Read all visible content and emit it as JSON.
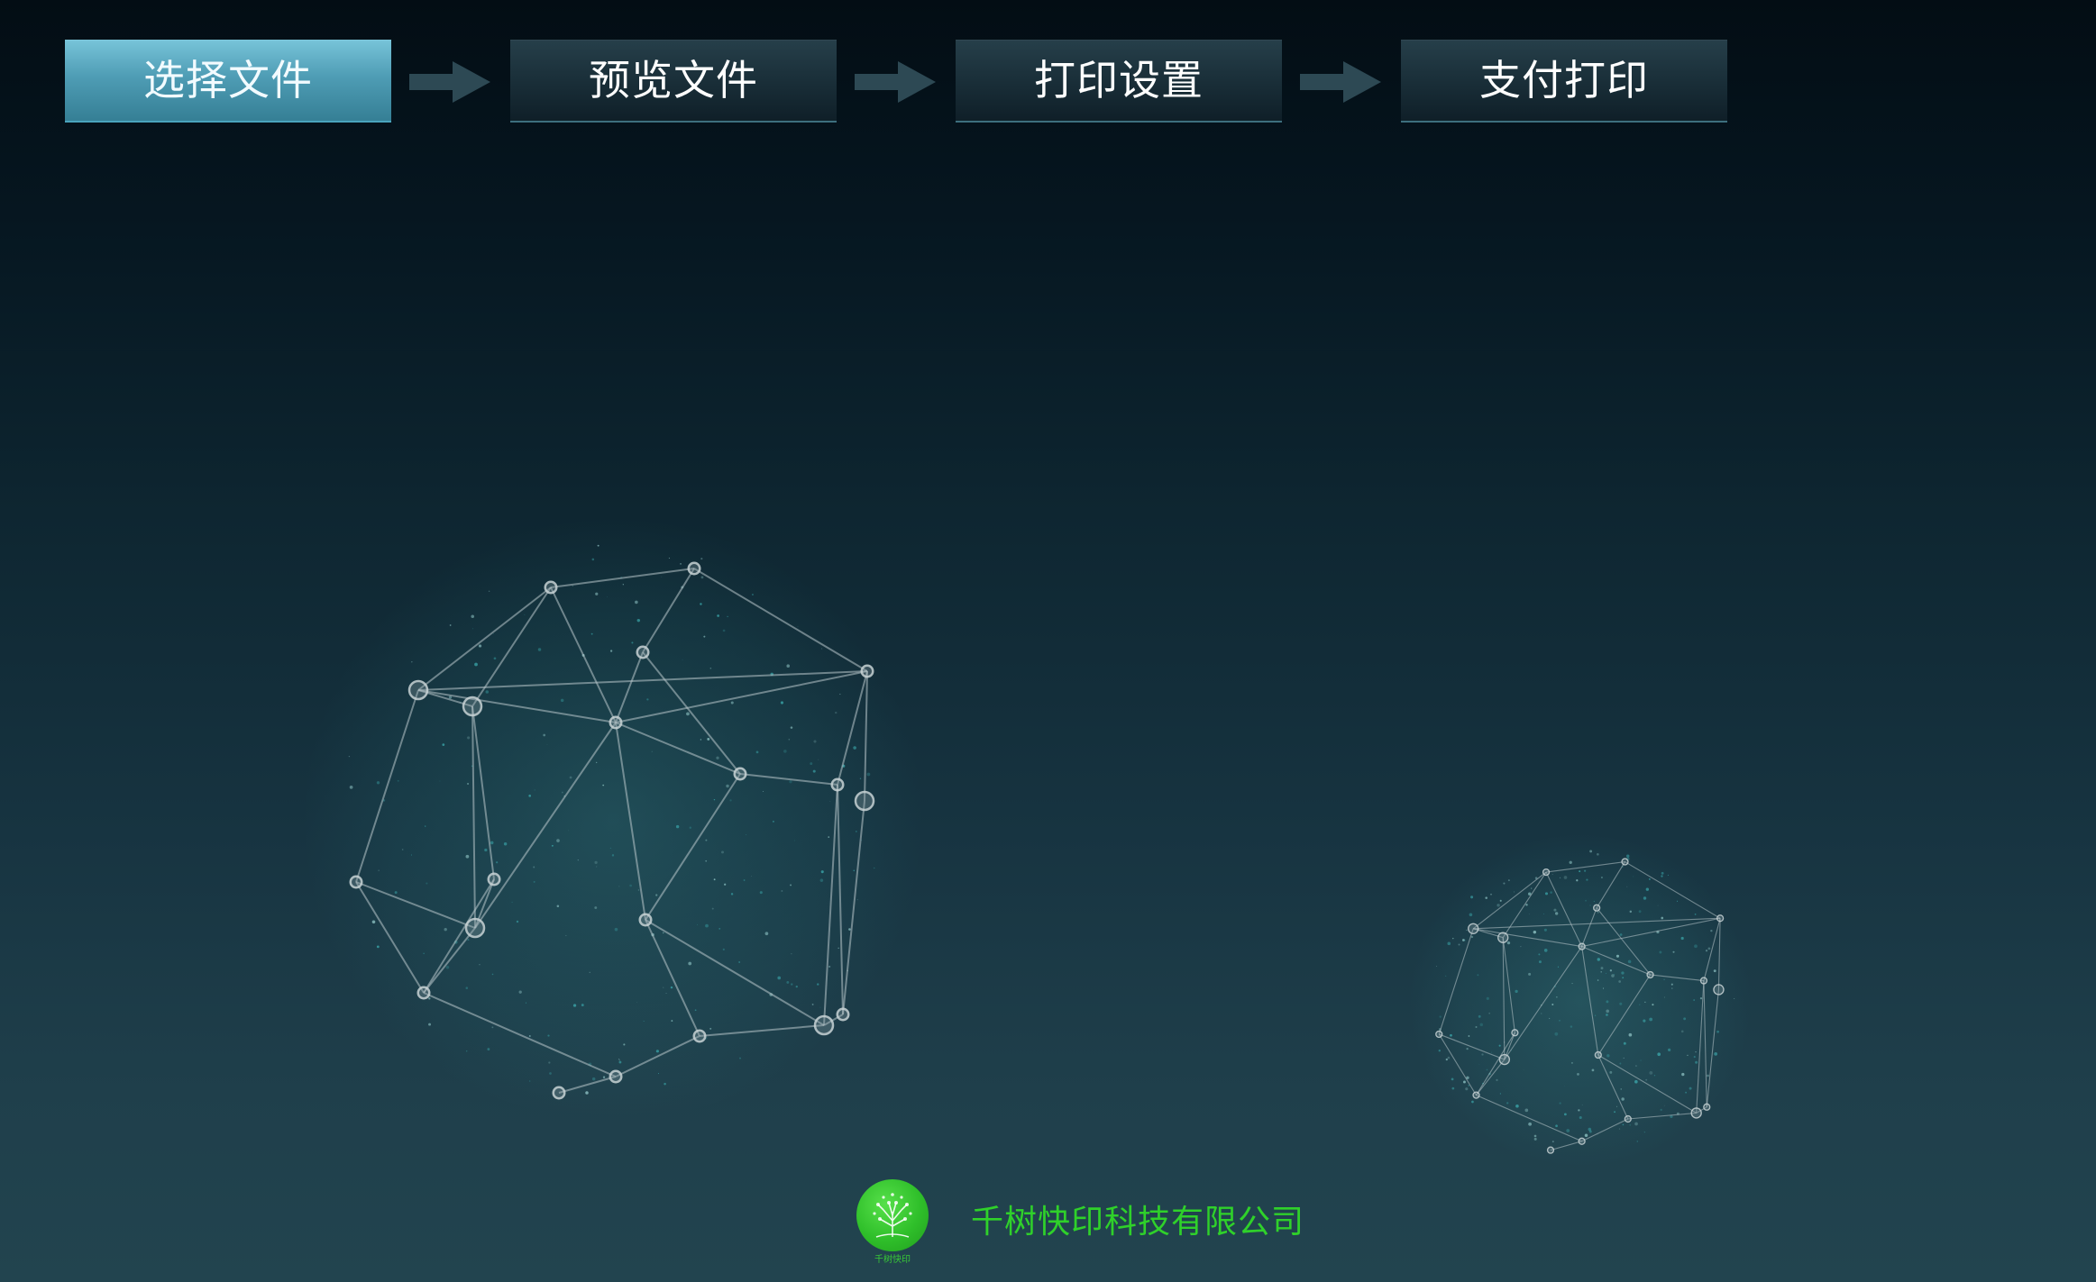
{
  "steps": [
    {
      "label": "选择文件",
      "active": true
    },
    {
      "label": "预览文件",
      "active": false
    },
    {
      "label": "打印设置",
      "active": false
    },
    {
      "label": "支付打印",
      "active": false
    }
  ],
  "footer": {
    "company_name": "千树快印科技有限公司",
    "logo_caption": "千树快印"
  },
  "colors": {
    "active_step": "#5aaec6",
    "inactive_step": "#1d333d",
    "brand_green": "#2fd12a",
    "network_line": "#b9c7cb",
    "network_glow": "#3fb4b7"
  },
  "icons": [
    "right-arrow-icon",
    "network-globe-decoration",
    "tree-logo-icon"
  ]
}
